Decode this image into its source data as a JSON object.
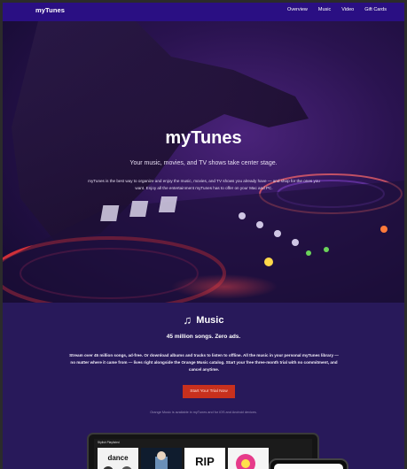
{
  "nav": {
    "brand": "myTunes",
    "links": [
      "Overview",
      "Music",
      "Video",
      "Gift Cards"
    ]
  },
  "hero": {
    "title": "myTunes",
    "subtitle": "Your music, movies, and TV shows take center stage.",
    "body": "myTunes is the best way to organize and enjoy the music, movies, and TV shows you already have — and shop for the ones you want. Enjoy all the entertainment myTunes has to offer on your Mac and PC."
  },
  "music": {
    "icon": "music-note-icon",
    "heading": "Music",
    "tagline": "45 million songs. Zero ads.",
    "body": "Stream over 45 million songs, ad-free. Or download albums and tracks to listen to offline. All the music in your personal myTunes library — no matter where it came from — lives right alongside the Orange Music catalog. Start your free three-month trial with no commitment, and cancel anytime.",
    "cta_label": "Start Your Trial Now",
    "availability": "Orange Music is available in myTunes and for iOS and Android devices."
  },
  "device": {
    "screen_title": "Stylish Playlisted",
    "album_labels": [
      "dance",
      "",
      "RIP",
      ""
    ]
  },
  "colors": {
    "nav_bg": "#2a0f83",
    "section_bg": "#28195a",
    "cta_bg": "#c8301d"
  }
}
